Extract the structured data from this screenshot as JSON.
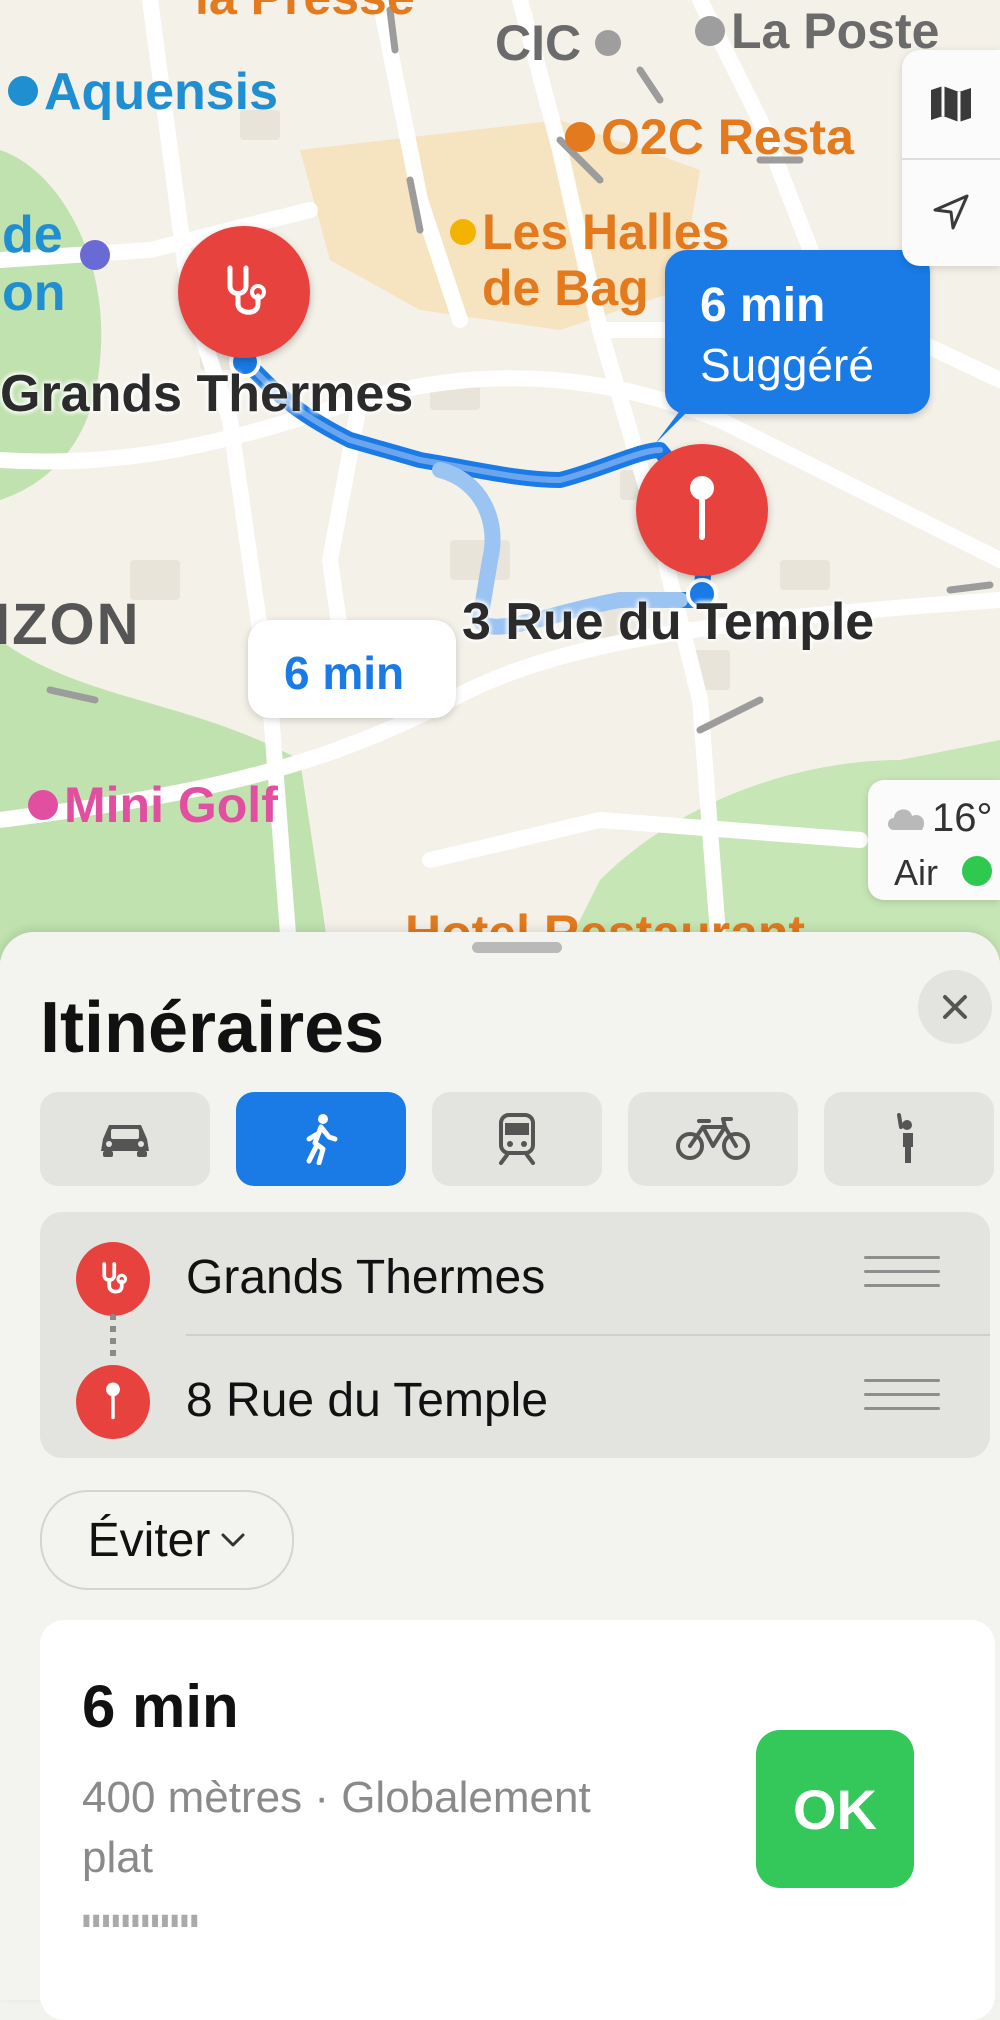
{
  "map": {
    "poi_labels": {
      "la_presse": "la Presse",
      "cic": "CIC",
      "la_poste": "La Poste",
      "aquensis": "Aquensis",
      "o2c": "O2C Resta",
      "les_halles_1": "Les Halles",
      "les_halles_2": "de Bag",
      "de_on_1": "de",
      "de_on_2": "on",
      "bizon": "IZON",
      "mini_golf": "Mini Golf",
      "hotel": "Hotel Restaurant"
    },
    "origin_label": "Grands Thermes",
    "destination_label": "3 Rue du Temple",
    "route_bubble": {
      "duration": "6 min",
      "tag": "Suggéré"
    },
    "alt_route_bubble": "6 min",
    "weather": {
      "temperature": "16°",
      "air_label": "Air",
      "air_color": "#2ec94e"
    },
    "controls": [
      "map-icon",
      "location-arrow-icon"
    ]
  },
  "sheet": {
    "title": "Itinéraires",
    "close_icon": "close-icon",
    "modes": [
      {
        "icon": "car-icon",
        "active": false
      },
      {
        "icon": "walk-icon",
        "active": true
      },
      {
        "icon": "train-icon",
        "active": false
      },
      {
        "icon": "bike-icon",
        "active": false
      },
      {
        "icon": "rideshare-icon",
        "active": false
      }
    ],
    "stops": [
      {
        "name": "Grands Thermes",
        "icon": "stethoscope-icon"
      },
      {
        "name": "8 Rue du Temple",
        "icon": "pin-icon"
      }
    ],
    "avoid_label": "Éviter",
    "route_card": {
      "duration": "6 min",
      "details": "400 mètres · Globalement plat",
      "button_label": "OK"
    }
  },
  "colors": {
    "accent": "#1a7ae6",
    "pin_red": "#e8423f",
    "go_green": "#34c759"
  }
}
